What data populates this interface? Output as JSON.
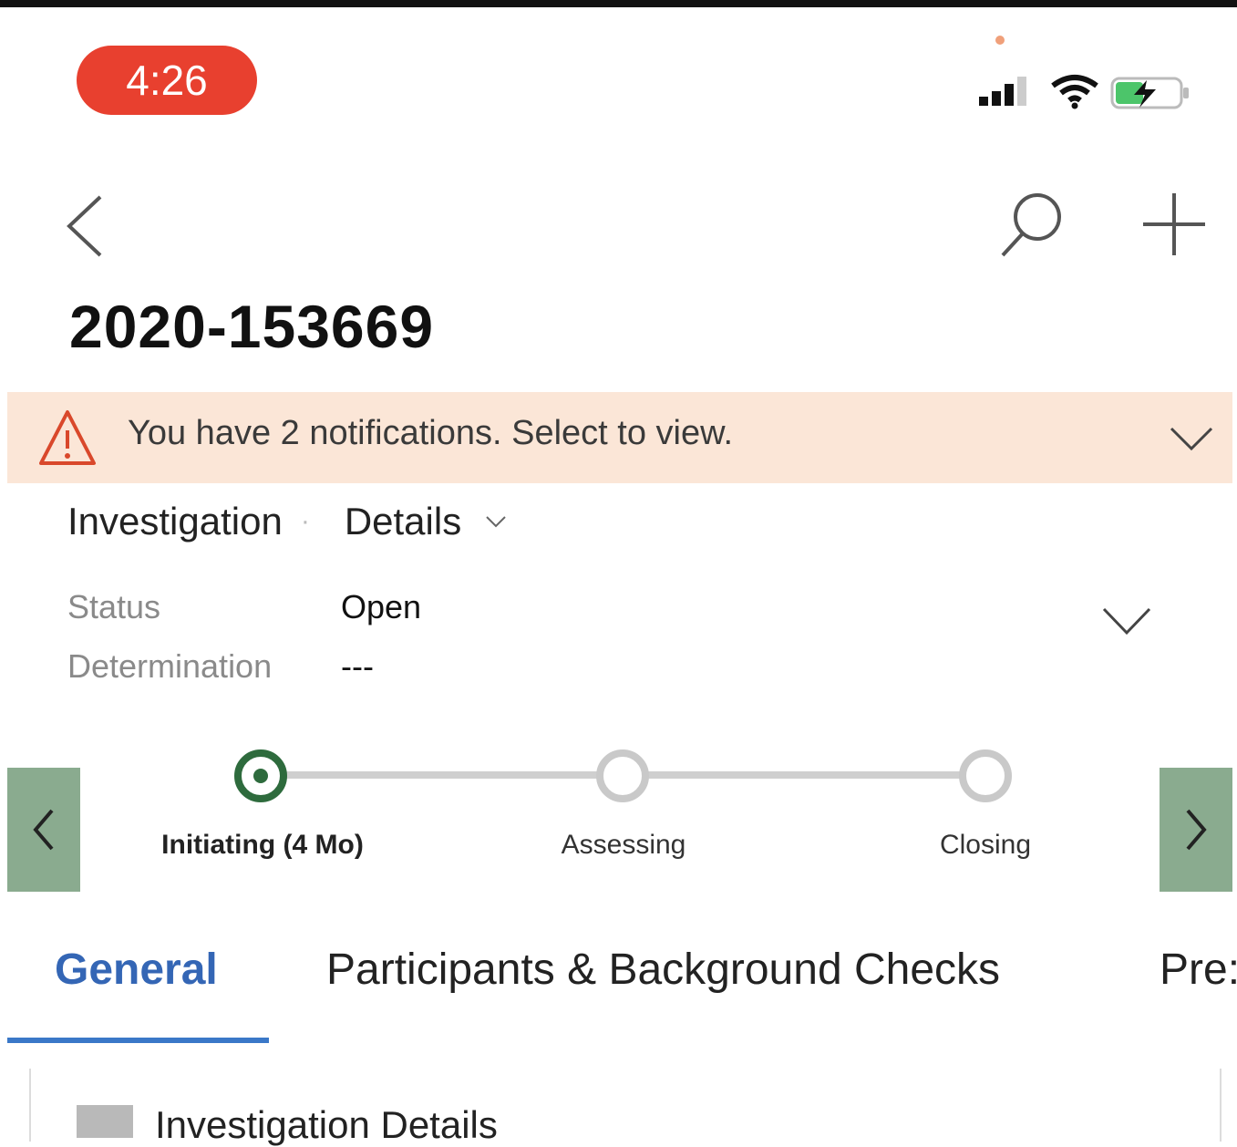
{
  "status_bar": {
    "time": "4:26"
  },
  "header": {
    "record_id": "2020-153669"
  },
  "notification": {
    "text": "You have 2 notifications. Select to view."
  },
  "form": {
    "entity": "Investigation",
    "form_name": "Details"
  },
  "fields": [
    {
      "label": "Status",
      "value": "Open"
    },
    {
      "label": "Determination",
      "value": "---"
    }
  ],
  "process": {
    "stages": [
      {
        "label": "Initiating (4 Mo)",
        "active": true
      },
      {
        "label": "Assessing",
        "active": false
      },
      {
        "label": "Closing",
        "active": false
      }
    ]
  },
  "tabs": [
    {
      "label": "General",
      "active": true
    },
    {
      "label": "Participants & Background Checks",
      "active": false
    },
    {
      "label": "Pre:",
      "active": false
    }
  ],
  "section": {
    "title": "Investigation Details"
  },
  "colors": {
    "accent": "#3466b5",
    "active_stage": "#2e6b3d",
    "banner": "#fbe6d7",
    "time_pill": "#e8402f"
  }
}
